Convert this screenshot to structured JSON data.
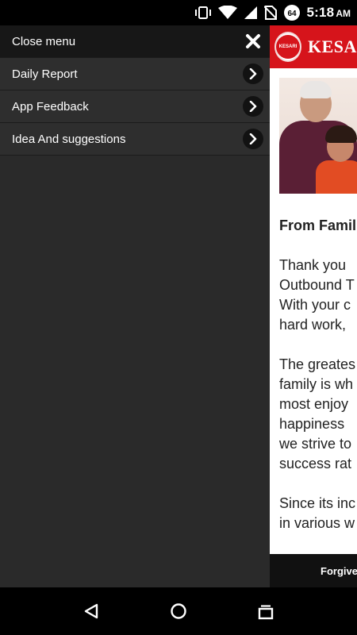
{
  "status_bar": {
    "time": "5:18",
    "ampm": "AM",
    "battery_level": "64",
    "icons": [
      "vibrate-icon",
      "wifi-icon",
      "signal-icon",
      "no-sim-icon",
      "battery-icon"
    ]
  },
  "menu": {
    "close_label": "Close menu",
    "items": [
      {
        "label": "Daily Report"
      },
      {
        "label": "App Feedback"
      },
      {
        "label": "Idea And suggestions"
      }
    ]
  },
  "app": {
    "brand": "KESARI",
    "logo_text": "KESARI",
    "article": {
      "heading": "From Famil",
      "para1": [
        "Thank you ",
        "Outbound T",
        "With your c",
        "hard work, "
      ],
      "para2": [
        "The greates",
        "family is wh",
        "most enjoy",
        "happiness ",
        "we strive to",
        "success rat"
      ],
      "para3": [
        "Since its inc",
        "in various w"
      ]
    },
    "footer_text": "Forgive"
  },
  "colors": {
    "brand_red": "#d6141b",
    "menu_bg": "#2a2a2a",
    "menu_item_bg": "#2e2e2e",
    "close_row_bg": "#171717"
  }
}
